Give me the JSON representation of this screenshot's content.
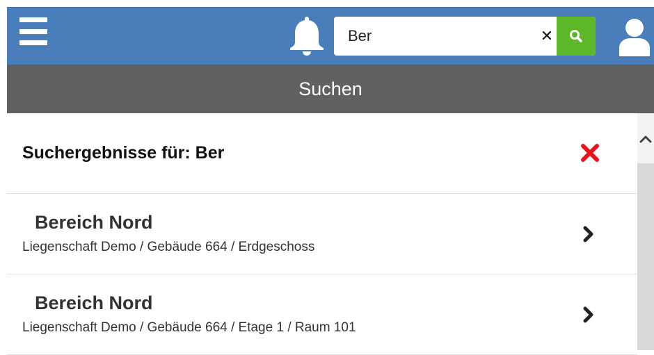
{
  "header": {
    "search": {
      "value": "Ber",
      "placeholder": ""
    },
    "clear_label": "✕",
    "icons": {
      "menu": "hamburger-icon",
      "notifications": "bell-icon",
      "search": "search-icon",
      "user": "user-icon"
    },
    "colors": {
      "header": "#4a7ebb",
      "search_button": "#5cb829"
    }
  },
  "titlebar": {
    "title": "Suchen"
  },
  "results": {
    "heading": "Suchergebnisse für: Ber",
    "close_color": "#e8141a",
    "items": [
      {
        "title": "Bereich Nord",
        "path": "Liegenschaft Demo / Gebäude 664 / Erdgeschoss"
      },
      {
        "title": "Bereich Nord",
        "path": "Liegenschaft Demo / Gebäude 664 / Etage 1 / Raum 101"
      }
    ]
  }
}
